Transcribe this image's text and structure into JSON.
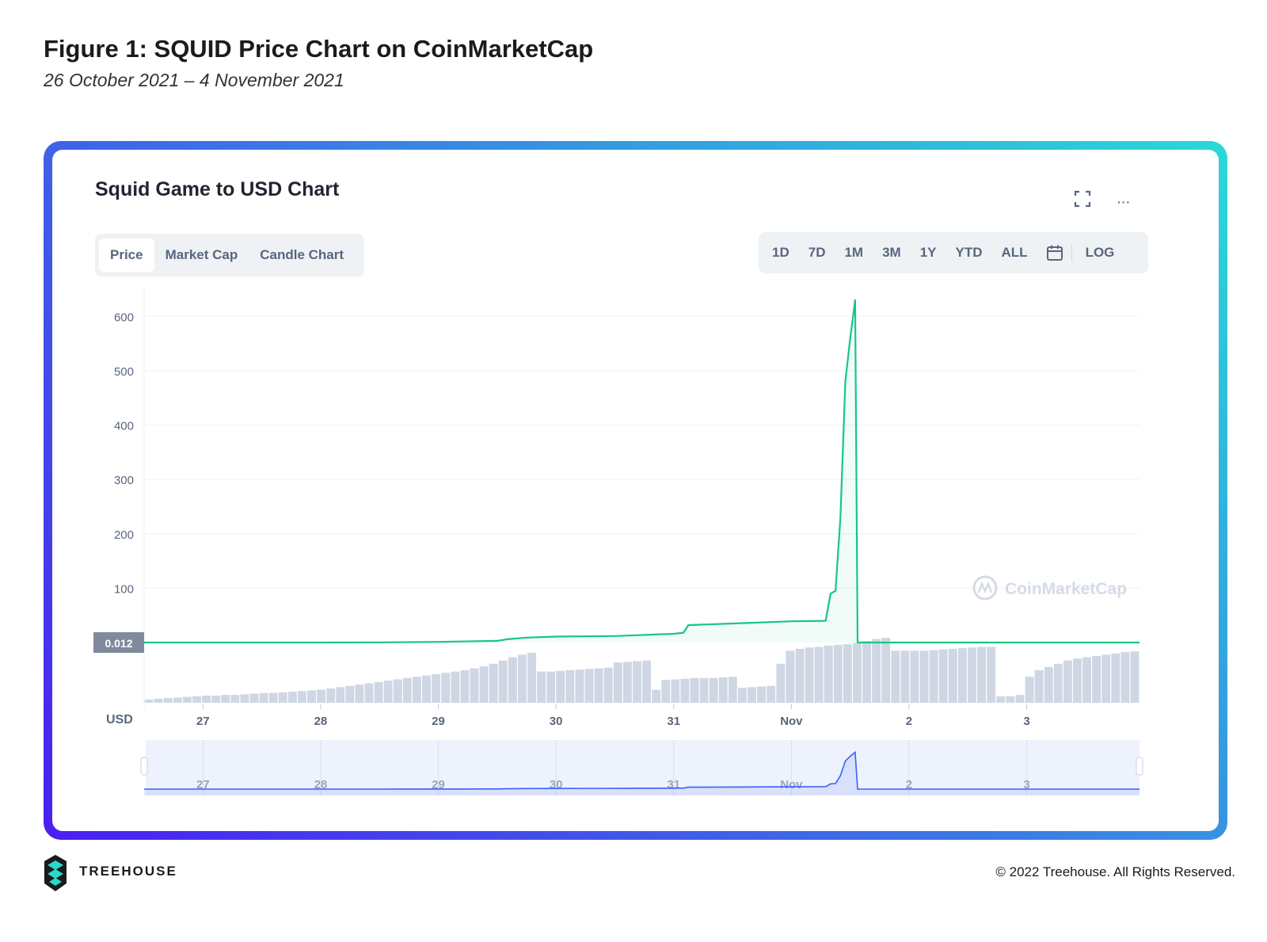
{
  "figure": {
    "title": "Figure 1: SQUID Price Chart on CoinMarketCap",
    "subtitle": "26 October 2021 – 4 November 2021"
  },
  "card": {
    "title": "Squid Game to USD Chart",
    "icons": [
      "fullscreen-icon",
      "more-icon"
    ],
    "more_label": "···"
  },
  "tabs": [
    {
      "label": "Price",
      "active": true
    },
    {
      "label": "Market Cap",
      "active": false
    },
    {
      "label": "Candle Chart",
      "active": false
    }
  ],
  "ranges": [
    "1D",
    "7D",
    "1M",
    "3M",
    "1Y",
    "YTD",
    "ALL"
  ],
  "log_label": "LOG",
  "colors": {
    "line": "#16c784",
    "volume": "#cfd6e4",
    "grid": "#eff2f5",
    "axis_text": "#58667e",
    "current_badge": "#808a9d",
    "navigator_bg": "#eef2fc",
    "navigator_line": "#3861fb",
    "frame_start": "#4a1ff0",
    "frame_end": "#2ad9d8"
  },
  "watermark": "CoinMarketCap",
  "chart_data": {
    "type": "line",
    "title": "Squid Game to USD Chart",
    "ylabel": "USD",
    "y_ticks": [
      "100",
      "200",
      "300",
      "400",
      "500",
      "600"
    ],
    "ylim": [
      0,
      650
    ],
    "x_ticks": [
      "27",
      "28",
      "29",
      "30",
      "31",
      "Nov",
      "2",
      "3"
    ],
    "xlim": [
      "2021-10-26T12:00",
      "2021-11-03T23:00"
    ],
    "current_price_label": "0.012",
    "series": [
      {
        "values": [
          [
            "2021-10-26T12:00",
            0.01
          ],
          [
            "2021-10-27T00:00",
            0.02
          ],
          [
            "2021-10-28T00:00",
            0.03
          ],
          [
            "2021-10-28T12:00",
            0.3
          ],
          [
            "2021-10-29T00:00",
            1.2
          ],
          [
            "2021-10-29T12:00",
            3
          ],
          [
            "2021-10-29T14:00",
            6
          ],
          [
            "2021-10-29T18:00",
            9
          ],
          [
            "2021-10-30T00:00",
            11
          ],
          [
            "2021-10-30T12:00",
            12
          ],
          [
            "2021-10-31T00:00",
            16
          ],
          [
            "2021-10-31T02:00",
            18
          ],
          [
            "2021-10-31T03:00",
            32
          ],
          [
            "2021-10-31T12:00",
            35
          ],
          [
            "2021-11-01T00:00",
            39
          ],
          [
            "2021-11-01T07:00",
            40
          ],
          [
            "2021-11-01T08:00",
            90
          ],
          [
            "2021-11-01T09:00",
            95
          ],
          [
            "2021-11-01T10:00",
            230
          ],
          [
            "2021-11-01T11:00",
            480
          ],
          [
            "2021-11-01T12:00",
            560
          ],
          [
            "2021-11-01T13:00",
            630
          ],
          [
            "2021-11-01T13:30",
            0.01
          ],
          [
            "2021-11-02T00:00",
            0.01
          ],
          [
            "2021-11-03T00:00",
            0.01
          ],
          [
            "2021-11-03T23:00",
            0.01
          ]
        ]
      }
    ],
    "volume_relative": [
      0.05,
      0.06,
      0.07,
      0.08,
      0.09,
      0.1,
      0.11,
      0.11,
      0.12,
      0.12,
      0.13,
      0.14,
      0.15,
      0.15,
      0.16,
      0.17,
      0.18,
      0.19,
      0.2,
      0.22,
      0.24,
      0.26,
      0.28,
      0.3,
      0.32,
      0.34,
      0.36,
      0.38,
      0.4,
      0.42,
      0.44,
      0.46,
      0.48,
      0.5,
      0.53,
      0.56,
      0.6,
      0.65,
      0.7,
      0.74,
      0.77,
      0.48,
      0.48,
      0.49,
      0.5,
      0.51,
      0.52,
      0.53,
      0.54,
      0.62,
      0.63,
      0.64,
      0.65,
      0.2,
      0.35,
      0.36,
      0.37,
      0.38,
      0.38,
      0.38,
      0.39,
      0.4,
      0.23,
      0.24,
      0.25,
      0.26,
      0.6,
      0.8,
      0.83,
      0.85,
      0.86,
      0.88,
      0.89,
      0.9,
      0.92,
      0.95,
      0.98,
      1.0,
      0.8,
      0.8,
      0.8,
      0.8,
      0.81,
      0.82,
      0.83,
      0.84,
      0.85,
      0.86,
      0.86,
      0.1,
      0.1,
      0.12,
      0.4,
      0.5,
      0.55,
      0.6,
      0.65,
      0.68,
      0.7,
      0.72,
      0.74,
      0.76,
      0.78,
      0.79
    ],
    "legend": "none",
    "grid": true
  }
}
